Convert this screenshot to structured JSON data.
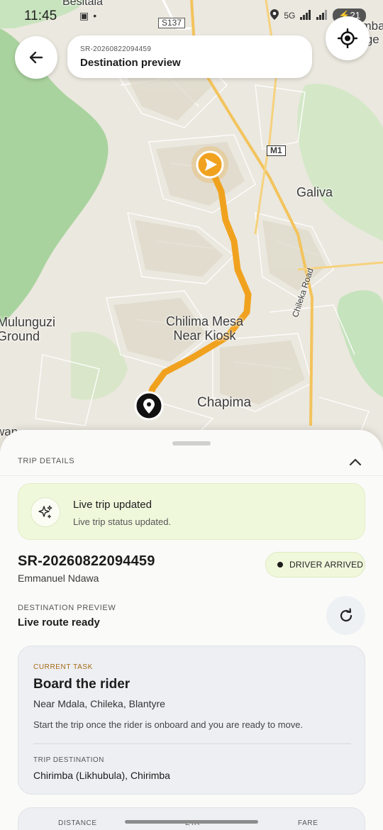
{
  "status_bar": {
    "time": "11:45",
    "network": "5G",
    "battery": "21"
  },
  "header": {
    "reference": "SR-20260822094459",
    "title": "Destination preview"
  },
  "map": {
    "labels": {
      "besitala": "Besitala",
      "road_s137": "S137",
      "road_m1": "M1",
      "galiva": "Galiva",
      "mulunguzi_ground": "Mulunguzi\nGround",
      "chilima": "Chilima Mesa\nNear Kiosk",
      "chapima": "Chapima",
      "chileka_road": "Chileka Road",
      "top_right": "Chimbani\nVillage",
      "left_edge": "wan"
    },
    "colors": {
      "route": "#f0a21f",
      "water_green": "#c5e3bd",
      "park_green": "#a9d39e",
      "land": "#ebe8df",
      "major_road": "#f3c35c"
    }
  },
  "sheet": {
    "header": "TRIP DETAILS",
    "notice": {
      "title": "Live trip updated",
      "subtitle": "Live trip status updated."
    },
    "trip_id": "SR-20260822094459",
    "rider_name": "Emmanuel Ndawa",
    "status": "DRIVER ARRIVED",
    "destination_preview_label": "DESTINATION PREVIEW",
    "destination_preview_value": "Live route ready",
    "task": {
      "kicker": "CURRENT TASK",
      "title": "Board the rider",
      "location": "Near Mdala, Chileka, Blantyre",
      "description": "Start the trip once the rider is onboard and you are ready to move.",
      "destination_label": "TRIP DESTINATION",
      "destination_value": "Chirimba (Likhubula), Chirimba"
    },
    "stats": {
      "distance_label": "DISTANCE",
      "eta_label": "ETA",
      "fare_label": "FARE"
    }
  },
  "icons": {
    "back": "arrow-left-icon",
    "locate": "crosshair-icon",
    "collapse": "chevron-up-icon",
    "notice": "sparkles-icon",
    "refresh": "refresh-icon",
    "origin": "navigation-arrow-icon",
    "destination": "map-pin-icon"
  }
}
